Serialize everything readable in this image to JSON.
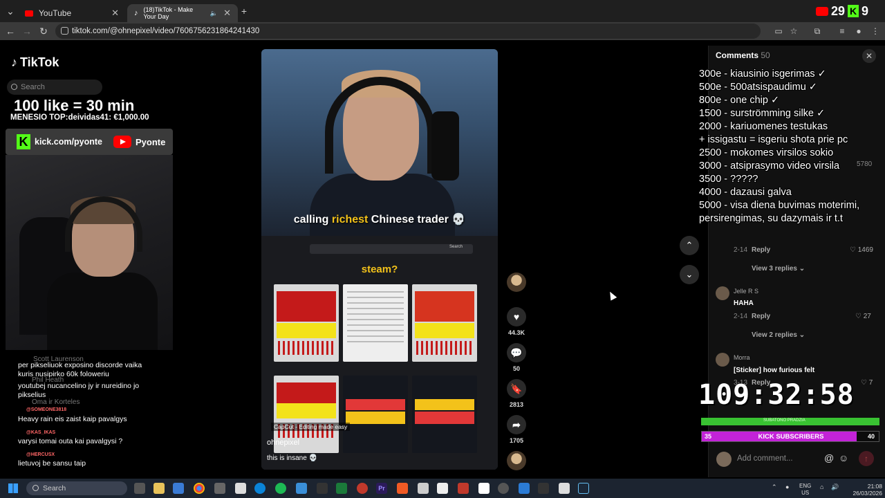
{
  "browser": {
    "tabs": [
      {
        "title": "YouTube"
      },
      {
        "title": "(18)TikTok - Make Your Day"
      }
    ],
    "url": "tiktok.com/@ohnepixel/video/7606756231864241430"
  },
  "overlay_top_right": {
    "yt_count": "29",
    "kick_count": "9"
  },
  "tiktok": {
    "logo": "TikTok",
    "search_placeholder": "Search"
  },
  "stream_overlay": {
    "like_goal": "100 like = 30 min",
    "month_top": "MENESIO TOP:deividas41: €1,000.00",
    "kick_url": "kick.com/pyonte",
    "yt_name": "Pyonte",
    "goals": [
      "300e - kiausinio isgerimas ✓",
      "500e - 500atsispaudimu ✓",
      "800e - one chip ✓",
      "1500 - surströmming silke ✓",
      "2000 - kariuomenes testukas",
      "+ issigastu = isgeriu shota prie pc",
      "2500 - mokomes virsilos sokio",
      "3000 - atsiprasymo video virsila",
      "3500 - ?????",
      "4000 - dazausi galva",
      "5000 - visa diena buvimas moterimi,",
      "persirengimas, su dazymais ir t.t"
    ],
    "timer": "109:32:58",
    "subathon_label": "SUBATONO PRADZIA",
    "kick_subs_label": "KICK SUBSCRIBERS",
    "kick_subs_current": "35",
    "kick_subs_goal": "40",
    "kick_subs_progress": 0.875
  },
  "chat": [
    {
      "ghost": "Scott Laurenson",
      "text": "per pikseliuok exposino discorde vaika kuris nusipirko 60k foloweriu"
    },
    {
      "ghost": "Phil Heath",
      "text": "youtubej nucancelino jy ir nureidino jo pikselius"
    },
    {
      "ghost": "Oma ir Korteles",
      "user": "@SOMEONE3818",
      "text": "Heavy rain eis zaist kaip pavalgys"
    },
    {
      "user": "@KAS_IKAS",
      "text": "varysi tomai outa kai pavalgysi ?"
    },
    {
      "user": "@HERCUSX",
      "text": "lietuvoj be sansu taip"
    }
  ],
  "video": {
    "caption_pre": "calling ",
    "caption_hl": "richest",
    "caption_post": " Chinese trader 💀",
    "steam_search_btn": "Search",
    "steam_question": "steam?",
    "capcut": "CapCut - Editing made easy",
    "author": "ohnepixel",
    "description": "this is insane 💀"
  },
  "actions": {
    "likes": "44.3K",
    "comments": "50",
    "saves": "2813",
    "shares": "1705"
  },
  "comments_panel": {
    "title": "Comments",
    "count": "50",
    "items": [
      {
        "date": "2-14",
        "reply": "Reply",
        "likes": "1469",
        "view_replies": "View 3 replies"
      },
      {
        "user": "Jelle R S",
        "text": "HAHA",
        "date": "2-14",
        "reply": "Reply",
        "likes": "27",
        "view_replies": "View 2 replies"
      },
      {
        "user": "Morra",
        "text": "[Sticker] how furious felt",
        "date": "3-13",
        "reply": "Reply",
        "likes": "7"
      }
    ],
    "top_likes": "5780",
    "add_placeholder": "Add comment..."
  },
  "taskbar": {
    "search": "Search",
    "lang": "ENG",
    "region": "US",
    "time": "21:08",
    "date": "26/03/2026"
  }
}
